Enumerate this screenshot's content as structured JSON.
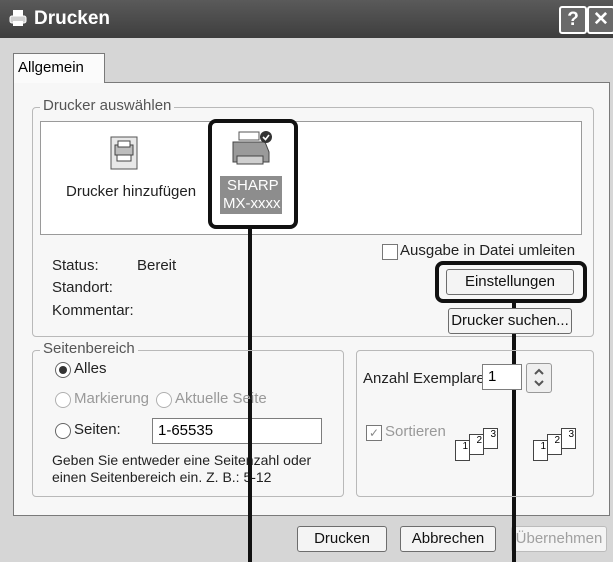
{
  "window": {
    "title": "Drucken",
    "help_glyph": "?",
    "close_glyph": "✕"
  },
  "tabs": [
    {
      "label": "Allgemein"
    }
  ],
  "printer_group": {
    "legend": "Drucker auswählen",
    "printers": [
      {
        "label": "Drucker hinzufügen"
      },
      {
        "label_line1": "SHARP",
        "label_line2": "MX-xxxx"
      }
    ]
  },
  "status": {
    "status_label": "Status:",
    "status_value": "Bereit",
    "location_label": "Standort:",
    "comment_label": "Kommentar:",
    "print_to_file_label": "Ausgabe in Datei umleiten",
    "settings_button": "Einstellungen",
    "find_printer_button": "Drucker suchen..."
  },
  "page_range": {
    "legend": "Seitenbereich",
    "all_label": "Alles",
    "selection_label": "Markierung",
    "current_page_label": "Aktuelle Seite",
    "pages_label": "Seiten:",
    "pages_value": "1-65535",
    "hint_line1": "Geben Sie entweder eine Seitenzahl oder",
    "hint_line2": "einen Seitenbereich ein. Z. B.: 5-12"
  },
  "copies": {
    "count_label": "Anzahl Exemplare:",
    "count_value": "1",
    "collate_label": "Sortieren",
    "pages": [
      "1",
      "2",
      "3"
    ]
  },
  "footer": {
    "print_button": "Drucken",
    "cancel_button": "Abbrechen",
    "apply_button": "Übernehmen"
  }
}
